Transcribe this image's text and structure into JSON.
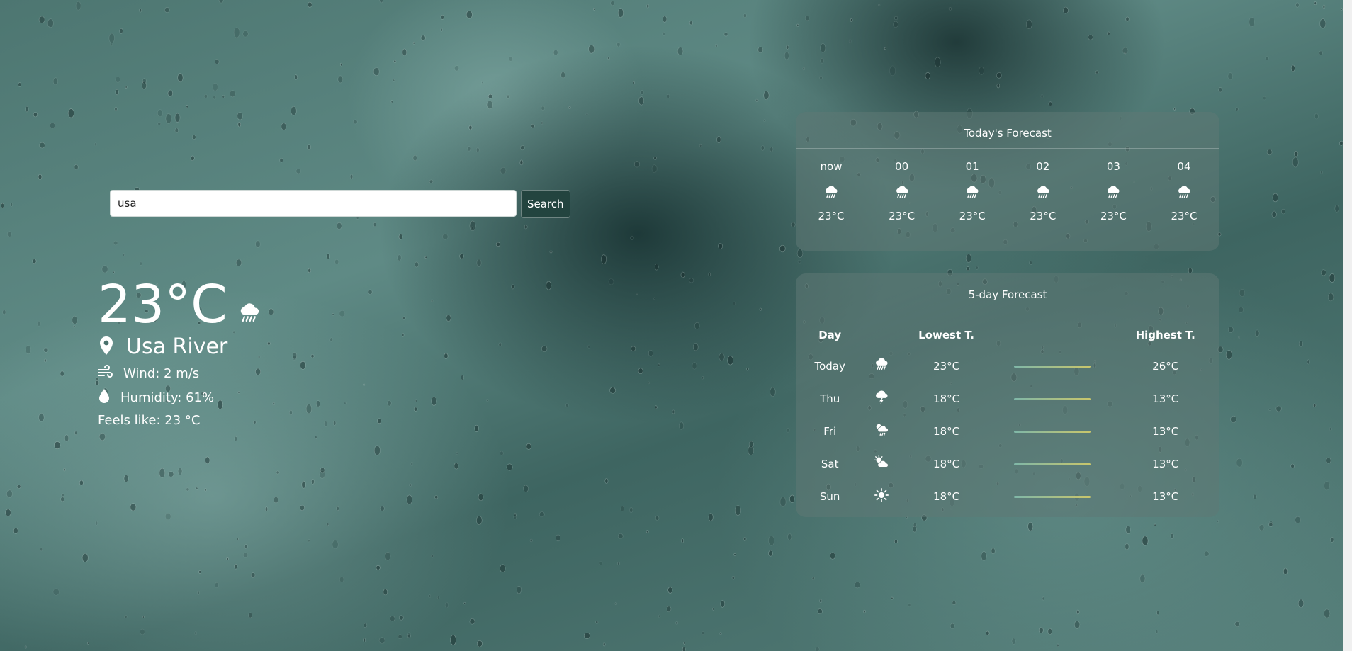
{
  "search": {
    "value": "usa",
    "button_label": "Search"
  },
  "current": {
    "temperature": "23°C",
    "weather_icon": "rain-cloud-icon",
    "city": "Usa River",
    "wind": "Wind: 2 m/s",
    "humidity": "Humidity: 61%",
    "feels_like": "Feels like: 23 °C"
  },
  "today": {
    "title": "Today's Forecast",
    "hours": [
      {
        "label": "now",
        "icon": "rain-cloud-icon",
        "temp": "23°C"
      },
      {
        "label": "00",
        "icon": "rain-cloud-icon",
        "temp": "23°C"
      },
      {
        "label": "01",
        "icon": "rain-cloud-icon",
        "temp": "23°C"
      },
      {
        "label": "02",
        "icon": "rain-cloud-icon",
        "temp": "23°C"
      },
      {
        "label": "03",
        "icon": "rain-cloud-icon",
        "temp": "23°C"
      },
      {
        "label": "04",
        "icon": "rain-cloud-icon",
        "temp": "23°C"
      }
    ]
  },
  "five_day": {
    "title": "5-day Forecast",
    "headers": {
      "day": "Day",
      "low": "Lowest T.",
      "high": "Highest T."
    },
    "days": [
      {
        "day": "Today",
        "icon": "rain-cloud-icon",
        "low": "23°C",
        "high": "26°C"
      },
      {
        "day": "Thu",
        "icon": "thunder-cloud-icon",
        "low": "18°C",
        "high": "13°C"
      },
      {
        "day": "Fri",
        "icon": "sun-rain-cloud-icon",
        "low": "18°C",
        "high": "13°C"
      },
      {
        "day": "Sat",
        "icon": "sun-cloud-icon",
        "low": "18°C",
        "high": "13°C"
      },
      {
        "day": "Sun",
        "icon": "sun-icon",
        "low": "18°C",
        "high": "13°C"
      }
    ]
  },
  "colors": {
    "search_button": "#23443f",
    "panel": "#5f7875",
    "bar_start": "#7fb7a8",
    "bar_end": "#c9c66b"
  }
}
